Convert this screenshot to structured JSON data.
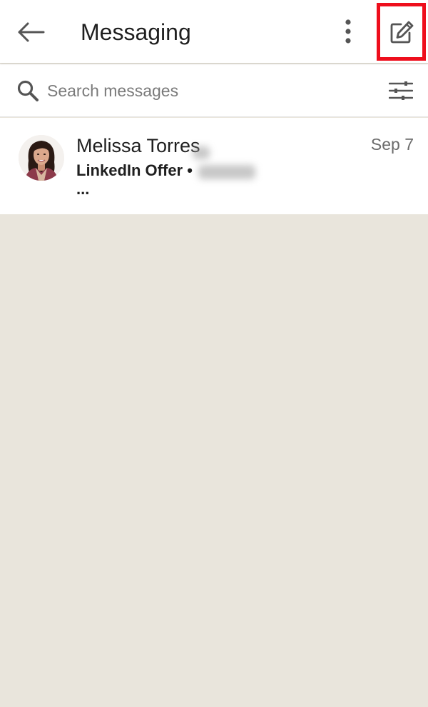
{
  "header": {
    "title": "Messaging",
    "back_icon": "arrow-left-icon",
    "more_icon": "vertical-dots-icon",
    "compose_icon": "compose-icon",
    "highlight_color": "#ee0e1c"
  },
  "search": {
    "placeholder": "Search messages",
    "value": "",
    "icon": "search-icon",
    "filter_icon": "sliders-icon"
  },
  "conversations": [
    {
      "name": "Melissa Torres",
      "date": "Sep 7",
      "subject": "LinkedIn Offer •",
      "preview": "..."
    }
  ],
  "colors": {
    "background": "#e9e5dc",
    "surface": "#ffffff",
    "text_primary": "#1f1f1f",
    "text_secondary": "#6b6b6b"
  }
}
